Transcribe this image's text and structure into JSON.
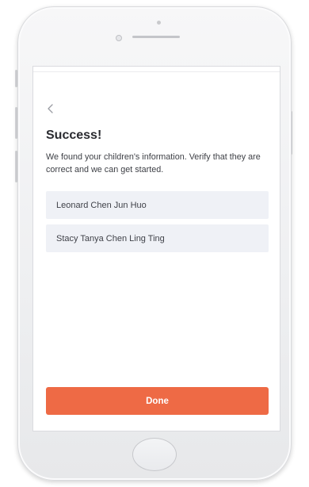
{
  "screen": {
    "title": "Success!",
    "message": "We found your children's information. Verify that they are correct and we can get started.",
    "back_icon": "chevron-left-icon",
    "children": [
      {
        "name": "Leonard Chen Jun Huo"
      },
      {
        "name": "Stacy Tanya Chen Ling Ting"
      }
    ],
    "done_label": "Done"
  },
  "colors": {
    "accent": "#ee6a45",
    "item_background": "#eff1f6",
    "text_primary": "#2a2b30"
  }
}
